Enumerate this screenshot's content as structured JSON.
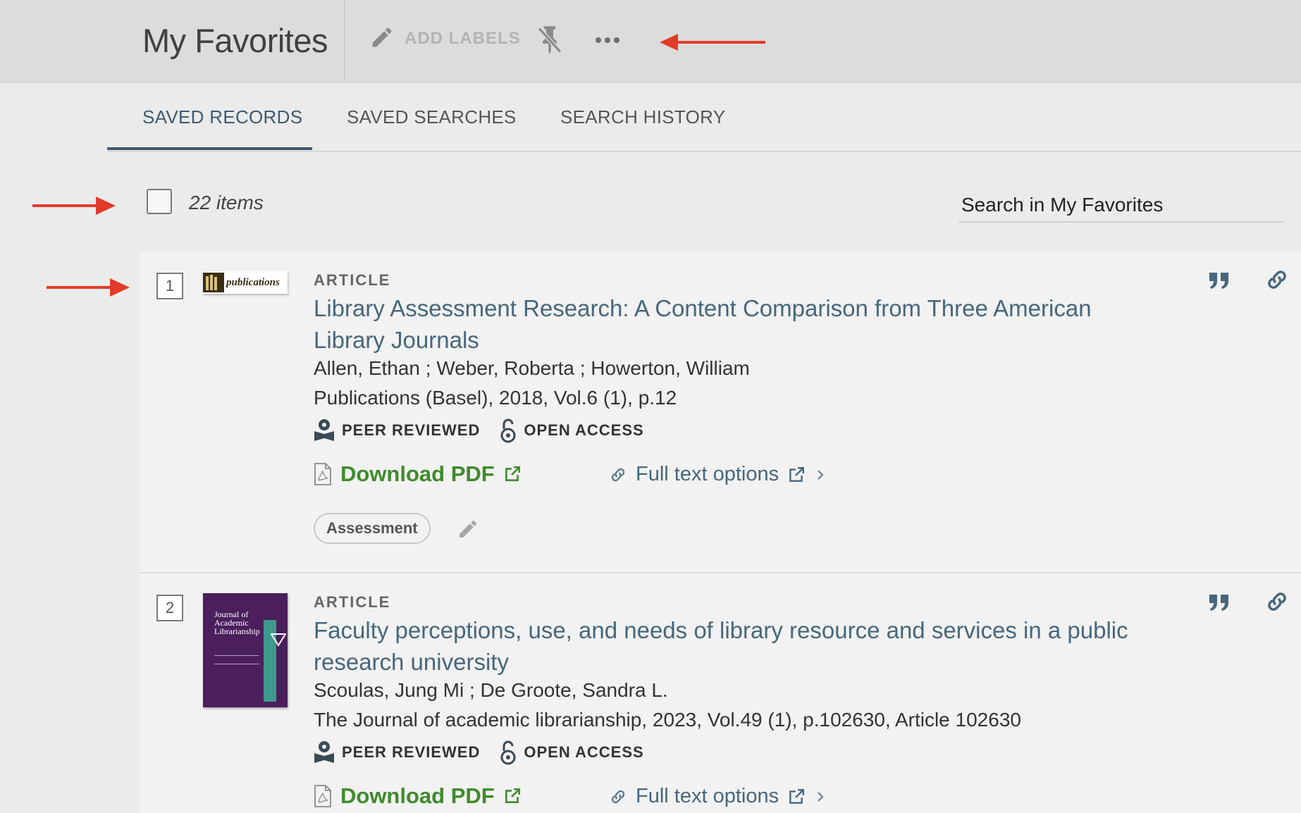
{
  "header": {
    "title": "My Favorites",
    "add_labels": "ADD LABELS",
    "icons": [
      "pencil-icon",
      "unpin-icon",
      "more-icon"
    ]
  },
  "tabs": [
    {
      "label": "SAVED RECORDS",
      "active": true
    },
    {
      "label": "SAVED SEARCHES",
      "active": false
    },
    {
      "label": "SEARCH HISTORY",
      "active": false
    }
  ],
  "toolbar": {
    "items_count": "22 items",
    "search_placeholder": "Search in My Favorites"
  },
  "colors": {
    "accent": "#3d5a74",
    "title_link": "#46677d",
    "download_green": "#3f8b2c",
    "annotation_arrow": "#e23b2a"
  },
  "records": [
    {
      "index": "1",
      "thumbnail_text": "publications",
      "type": "ARTICLE",
      "title_line1": "Library Assessment Research: A Content Comparison from Three American",
      "title_line2": "Library Journals",
      "authors": "Allen, Ethan ; Weber, Roberta ; Howerton, William",
      "source": "Publications (Basel), 2018, Vol.6 (1), p.12",
      "badges": [
        "PEER REVIEWED",
        "OPEN ACCESS"
      ],
      "download": "Download PDF",
      "fulltext": "Full text options",
      "label": "Assessment"
    },
    {
      "index": "2",
      "thumbnail_text": "Journal of Academic Librarianship",
      "type": "ARTICLE",
      "title_line1": "Faculty perceptions, use, and needs of library resource and services in a public",
      "title_line2": "research university",
      "authors": "Scoulas, Jung Mi ; De Groote, Sandra L.",
      "source": "The Journal of academic librarianship, 2023, Vol.49 (1), p.102630, Article 102630",
      "badges": [
        "PEER REVIEWED",
        "OPEN ACCESS"
      ],
      "download": "Download PDF",
      "fulltext": "Full text options"
    }
  ]
}
